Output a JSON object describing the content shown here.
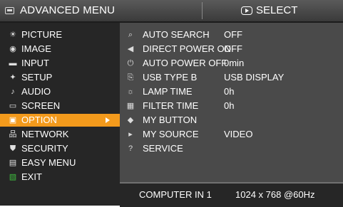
{
  "header": {
    "title": "ADVANCED MENU",
    "select_label": "SELECT"
  },
  "menu": {
    "items": [
      {
        "label": "PICTURE",
        "icon": "picture-icon",
        "glyph": "☀"
      },
      {
        "label": "IMAGE",
        "icon": "image-icon",
        "glyph": "◉"
      },
      {
        "label": "INPUT",
        "icon": "input-icon",
        "glyph": "▬"
      },
      {
        "label": "SETUP",
        "icon": "setup-icon",
        "glyph": "✦"
      },
      {
        "label": "AUDIO",
        "icon": "audio-icon",
        "glyph": "♪"
      },
      {
        "label": "SCREEN",
        "icon": "screen-icon",
        "glyph": "▭"
      },
      {
        "label": "OPTION",
        "icon": "option-icon",
        "glyph": "▣"
      },
      {
        "label": "NETWORK",
        "icon": "network-icon",
        "glyph": "品"
      },
      {
        "label": "SECURITY",
        "icon": "security-icon",
        "glyph": "⛊"
      },
      {
        "label": "EASY MENU",
        "icon": "easy-menu-icon",
        "glyph": "▤"
      },
      {
        "label": "EXIT",
        "icon": "exit-icon",
        "glyph": "▧"
      }
    ],
    "selected": "OPTION"
  },
  "options": {
    "rows": [
      {
        "label": "AUTO SEARCH",
        "value": "OFF",
        "icon": "auto-search-icon",
        "glyph": "⌕"
      },
      {
        "label": "DIRECT POWER ON",
        "value": "OFF",
        "icon": "direct-power-on-icon",
        "glyph": "◀"
      },
      {
        "label": "AUTO POWER OFF",
        "value": "0min",
        "icon": "auto-power-off-icon",
        "glyph": "⏻"
      },
      {
        "label": "USB TYPE B",
        "value": "USB DISPLAY",
        "icon": "usb-type-b-icon",
        "glyph": "⎘"
      },
      {
        "label": "LAMP TIME",
        "value": "0h",
        "icon": "lamp-time-icon",
        "glyph": "☼"
      },
      {
        "label": "FILTER TIME",
        "value": "0h",
        "icon": "filter-time-icon",
        "glyph": "▦"
      },
      {
        "label": "MY BUTTON",
        "value": "",
        "icon": "my-button-icon",
        "glyph": "◆"
      },
      {
        "label": "MY SOURCE",
        "value": "VIDEO",
        "icon": "my-source-icon",
        "glyph": "▸"
      },
      {
        "label": "SERVICE",
        "value": "",
        "icon": "service-icon",
        "glyph": "?"
      }
    ]
  },
  "footer": {
    "source": "COMPUTER IN 1",
    "resolution": "1024 x 768 @60Hz"
  },
  "colors": {
    "accent": "#f39a1c",
    "panel_left": "#262626",
    "panel_right": "#4a4a4a"
  }
}
